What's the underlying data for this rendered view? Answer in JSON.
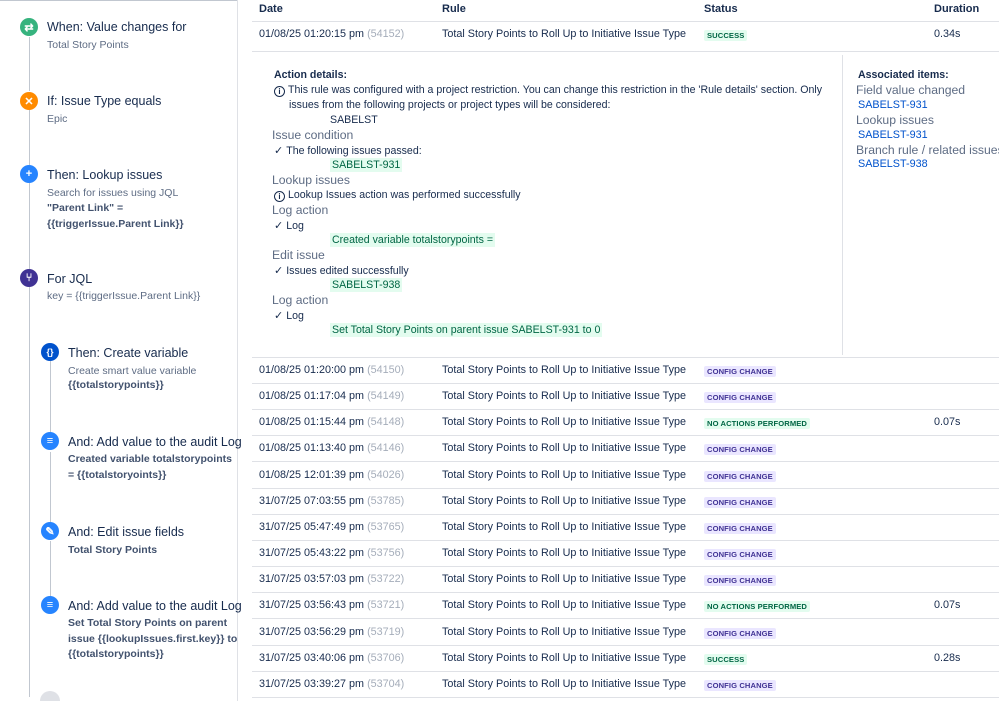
{
  "rule": {
    "steps": [
      {
        "icon": "value-changes-icon",
        "color": "#36b37e",
        "glyph": "⇄",
        "title": "When: Value changes for",
        "sub": "Total Story Points"
      },
      {
        "icon": "issue-type-condition-icon",
        "color": "#ff8b00",
        "glyph": "✕",
        "title": "If: Issue Type equals",
        "sub": "Epic"
      },
      {
        "icon": "lookup-issues-icon",
        "color": "#2684ff",
        "glyph": "+",
        "title": "Then: Lookup issues",
        "sub": "Search for issues using JQL",
        "code": "\"Parent Link\" = {{triggerIssue.Parent Link}}"
      },
      {
        "icon": "branch-jql-icon",
        "color": "#403294",
        "glyph": "⑂",
        "title": "For JQL",
        "code": "key = {{triggerIssue.Parent Link}}"
      },
      {
        "icon": "create-variable-icon",
        "color": "#0052cc",
        "glyph": "{}",
        "title": "Then: Create variable",
        "sub": "Create smart value variable",
        "code": "{{totalstorypoints}}"
      },
      {
        "icon": "audit-log-icon",
        "color": "#2684ff",
        "glyph": "≡",
        "title": "And: Add value to the audit Log",
        "code": "Created variable totalstorypoints = {{totalstoryoints}}"
      },
      {
        "icon": "edit-issue-icon",
        "color": "#2684ff",
        "glyph": "✎",
        "title": "And: Edit issue fields",
        "code": "Total Story Points"
      },
      {
        "icon": "audit-log-icon",
        "color": "#2684ff",
        "glyph": "≡",
        "title": "And: Add value to the audit Log",
        "code": "Set Total Story Points on parent issue {{lookupIssues.first.key}} to {{totalstorypoints}}"
      }
    ]
  },
  "table": {
    "headers": {
      "date": "Date",
      "rule": "Rule",
      "status": "Status",
      "duration": "Duration"
    },
    "status_colors": {
      "SUCCESS": {
        "bg": "#e3fcef",
        "fg": "#006644"
      },
      "CONFIG CHANGE": {
        "bg": "#eae6ff",
        "fg": "#403294"
      },
      "NO ACTIONS PERFORMED": {
        "bg": "#e3fcef",
        "fg": "#006644"
      }
    },
    "rows": [
      {
        "date": "01/08/25 01:20:15 pm",
        "id": "(54152)",
        "rule": "Total Story Points to Roll Up to Initiative Issue Type",
        "status": "SUCCESS",
        "duration": "0.34s"
      },
      {
        "date": "01/08/25 01:20:00 pm",
        "id": "(54150)",
        "rule": "Total Story Points to Roll Up to Initiative Issue Type",
        "status": "CONFIG CHANGE",
        "duration": ""
      },
      {
        "date": "01/08/25 01:17:04 pm",
        "id": "(54149)",
        "rule": "Total Story Points to Roll Up to Initiative Issue Type",
        "status": "CONFIG CHANGE",
        "duration": ""
      },
      {
        "date": "01/08/25 01:15:44 pm",
        "id": "(54148)",
        "rule": "Total Story Points to Roll Up to Initiative Issue Type",
        "status": "NO ACTIONS PERFORMED",
        "duration": "0.07s"
      },
      {
        "date": "01/08/25 01:13:40 pm",
        "id": "(54146)",
        "rule": "Total Story Points to Roll Up to Initiative Issue Type",
        "status": "CONFIG CHANGE",
        "duration": ""
      },
      {
        "date": "01/08/25 12:01:39 pm",
        "id": "(54026)",
        "rule": "Total Story Points to Roll Up to Initiative Issue Type",
        "status": "CONFIG CHANGE",
        "duration": ""
      },
      {
        "date": "31/07/25 07:03:55 pm",
        "id": "(53785)",
        "rule": "Total Story Points to Roll Up to Initiative Issue Type",
        "status": "CONFIG CHANGE",
        "duration": ""
      },
      {
        "date": "31/07/25 05:47:49 pm",
        "id": "(53765)",
        "rule": "Total Story Points to Roll Up to Initiative Issue Type",
        "status": "CONFIG CHANGE",
        "duration": ""
      },
      {
        "date": "31/07/25 05:43:22 pm",
        "id": "(53756)",
        "rule": "Total Story Points to Roll Up to Initiative Issue Type",
        "status": "CONFIG CHANGE",
        "duration": ""
      },
      {
        "date": "31/07/25 03:57:03 pm",
        "id": "(53722)",
        "rule": "Total Story Points to Roll Up to Initiative Issue Type",
        "status": "CONFIG CHANGE",
        "duration": ""
      },
      {
        "date": "31/07/25 03:56:43 pm",
        "id": "(53721)",
        "rule": "Total Story Points to Roll Up to Initiative Issue Type",
        "status": "NO ACTIONS PERFORMED",
        "duration": "0.07s"
      },
      {
        "date": "31/07/25 03:56:29 pm",
        "id": "(53719)",
        "rule": "Total Story Points to Roll Up to Initiative Issue Type",
        "status": "CONFIG CHANGE",
        "duration": ""
      },
      {
        "date": "31/07/25 03:40:06 pm",
        "id": "(53706)",
        "rule": "Total Story Points to Roll Up to Initiative Issue Type",
        "status": "SUCCESS",
        "duration": "0.28s"
      },
      {
        "date": "31/07/25 03:39:27 pm",
        "id": "(53704)",
        "rule": "Total Story Points to Roll Up to Initiative Issue Type",
        "status": "CONFIG CHANGE",
        "duration": ""
      }
    ]
  },
  "details": {
    "action_details_label": "Action details:",
    "restriction_line1": "This rule was configured with a project restriction. You can change this restriction in the 'Rule details' section. Only",
    "restriction_line2": "issues from the following projects or project types will be considered:",
    "project": "SABELST",
    "issue_condition_label": "Issue condition",
    "issues_passed": "The following issues passed:",
    "passed_issue": "SABELST-931",
    "lookup_label": "Lookup issues",
    "lookup_result": "Lookup Issues action was performed successfully",
    "log_action_label_1": "Log action",
    "log_1": "Log",
    "log_1_value": "Created variable totalstorypoints =",
    "edit_issue_label": "Edit issue",
    "edit_result": "Issues edited successfully",
    "edited_issue": "SABELST-938",
    "log_action_label_2": "Log action",
    "log_2": "Log",
    "log_2_value": "Set Total Story Points on parent issue SABELST-931 to 0",
    "associated_label": "Associated items:",
    "field_value_changed_label": "Field value changed",
    "field_value_changed_issue": "SABELST-931",
    "lookup_issues_label": "Lookup issues",
    "lookup_issues_issue": "SABELST-931",
    "branch_label": "Branch rule / related issues",
    "branch_issue": "SABELST-938"
  }
}
